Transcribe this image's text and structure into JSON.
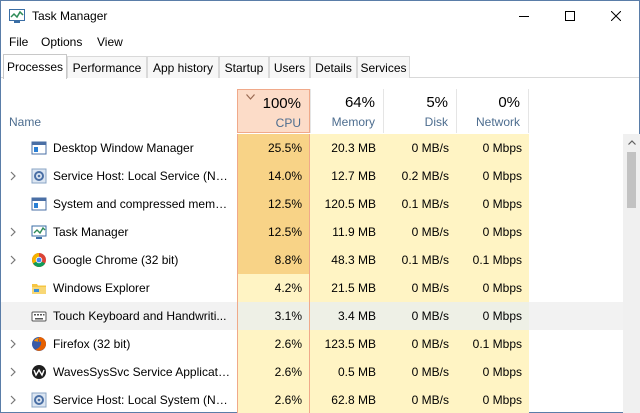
{
  "window": {
    "title": "Task Manager"
  },
  "menu": {
    "file": "File",
    "options": "Options",
    "view": "View"
  },
  "tabs": [
    {
      "label": "Processes",
      "active": true
    },
    {
      "label": "Performance"
    },
    {
      "label": "App history"
    },
    {
      "label": "Startup"
    },
    {
      "label": "Users"
    },
    {
      "label": "Details"
    },
    {
      "label": "Services"
    }
  ],
  "columns": {
    "name": "Name",
    "cpu": {
      "pct": "100%",
      "label": "CPU"
    },
    "memory": {
      "pct": "64%",
      "label": "Memory"
    },
    "disk": {
      "pct": "5%",
      "label": "Disk"
    },
    "network": {
      "pct": "0%",
      "label": "Network"
    }
  },
  "processes": [
    {
      "name": "Desktop Window Manager",
      "expandable": false,
      "icon": "dwm-icon",
      "cpu": "25.5%",
      "memory": "20.3 MB",
      "disk": "0 MB/s",
      "network": "0 Mbps"
    },
    {
      "name": "Service Host: Local Service (No ...",
      "expandable": true,
      "icon": "gear-icon",
      "cpu": "14.0%",
      "memory": "12.7 MB",
      "disk": "0.2 MB/s",
      "network": "0 Mbps"
    },
    {
      "name": "System and compressed memory",
      "expandable": false,
      "icon": "system-icon",
      "cpu": "12.5%",
      "memory": "120.5 MB",
      "disk": "0.1 MB/s",
      "network": "0 Mbps"
    },
    {
      "name": "Task Manager",
      "expandable": true,
      "icon": "task-manager-icon",
      "cpu": "12.5%",
      "memory": "11.9 MB",
      "disk": "0 MB/s",
      "network": "0 Mbps"
    },
    {
      "name": "Google Chrome (32 bit)",
      "expandable": true,
      "icon": "chrome-icon",
      "cpu": "8.8%",
      "memory": "48.3 MB",
      "disk": "0.1 MB/s",
      "network": "0.1 Mbps"
    },
    {
      "name": "Windows Explorer",
      "expandable": false,
      "icon": "folder-icon",
      "cpu": "4.2%",
      "memory": "21.5 MB",
      "disk": "0 MB/s",
      "network": "0 Mbps"
    },
    {
      "name": "Touch Keyboard and Handwriti...",
      "expandable": false,
      "icon": "keyboard-icon",
      "cpu": "3.1%",
      "memory": "3.4 MB",
      "disk": "0 MB/s",
      "network": "0 Mbps",
      "selected": true
    },
    {
      "name": "Firefox (32 bit)",
      "expandable": true,
      "icon": "firefox-icon",
      "cpu": "2.6%",
      "memory": "123.5 MB",
      "disk": "0 MB/s",
      "network": "0.1 Mbps"
    },
    {
      "name": "WavesSysSvc Service Application",
      "expandable": true,
      "icon": "waves-icon",
      "cpu": "2.6%",
      "memory": "0.5 MB",
      "disk": "0 MB/s",
      "network": "0 Mbps"
    },
    {
      "name": "Service Host: Local System (Net...",
      "expandable": true,
      "icon": "gear-icon",
      "cpu": "2.6%",
      "memory": "62.8 MB",
      "disk": "0 MB/s",
      "network": "0 Mbps"
    }
  ]
}
